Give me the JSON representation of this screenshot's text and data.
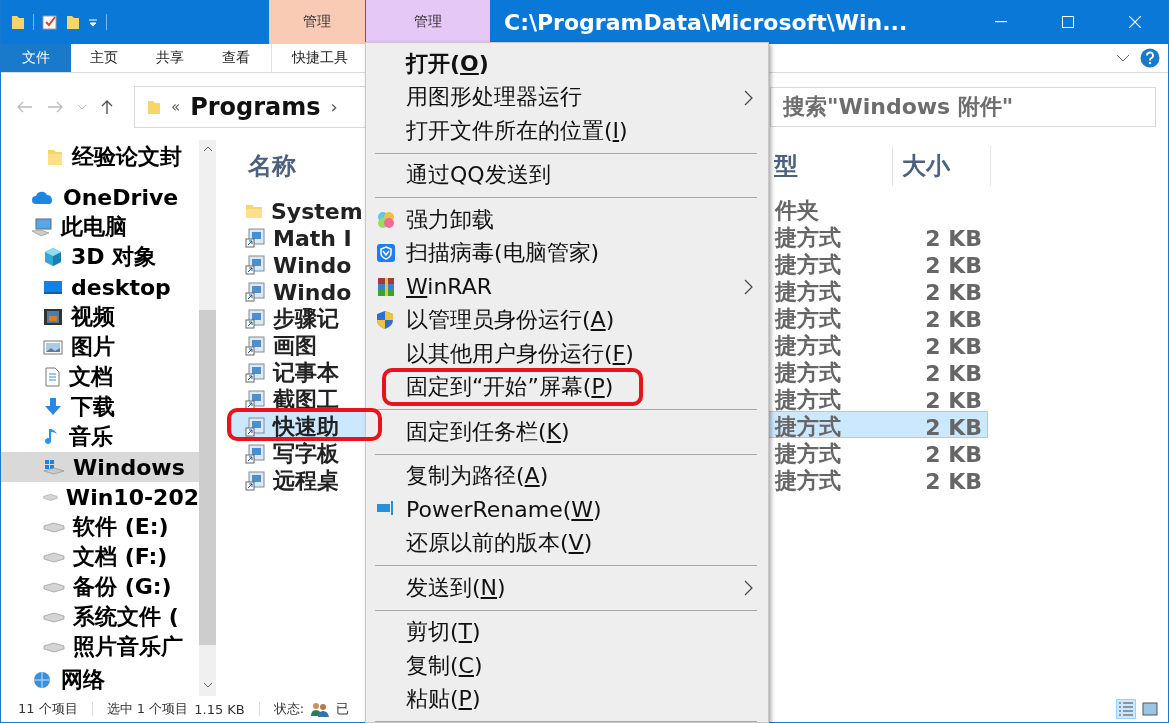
{
  "window": {
    "title": "C:\\ProgramData\\Microsoft\\Win...",
    "context_tabs": [
      {
        "label": "管理",
        "color": "#f9cbb5"
      },
      {
        "label": "管理",
        "color": "#e6c8f7"
      }
    ]
  },
  "ribbon_tabs": [
    {
      "label": "文件",
      "kind": "file",
      "selected": false
    },
    {
      "label": "主页",
      "kind": "tab",
      "selected": false
    },
    {
      "label": "共享",
      "kind": "tab",
      "selected": false
    },
    {
      "label": "查看",
      "kind": "tab",
      "selected": false
    },
    {
      "label": "快捷工具",
      "kind": "context",
      "selected": false
    }
  ],
  "address": {
    "overflow": "«",
    "crumb": "Programs",
    "separator": "›"
  },
  "search": {
    "placeholder": "搜索\"Windows 附件\""
  },
  "nav": [
    {
      "label": "经验论文封",
      "kind": "pinned-folder"
    },
    {
      "label": "OneDrive",
      "kind": "cloud"
    },
    {
      "label": "此电脑",
      "kind": "pc",
      "selected": false,
      "children": [
        {
          "label": "3D 对象",
          "kind": "cube",
          "selected": false
        },
        {
          "label": "desktop",
          "kind": "desktop",
          "selected": false
        },
        {
          "label": "视频",
          "kind": "video",
          "selected": false
        },
        {
          "label": "图片",
          "kind": "pictures",
          "selected": false
        },
        {
          "label": "文档",
          "kind": "documents",
          "selected": false
        },
        {
          "label": "下载",
          "kind": "downloads",
          "selected": false
        },
        {
          "label": "音乐",
          "kind": "music",
          "selected": false
        },
        {
          "label": "Windows",
          "kind": "system-drive",
          "selected": true
        },
        {
          "label": "Win10-202",
          "kind": "drive",
          "selected": false
        },
        {
          "label": "软件 (E:)",
          "kind": "drive",
          "selected": false
        },
        {
          "label": "文档 (F:)",
          "kind": "drive",
          "selected": false
        },
        {
          "label": "备份 (G:)",
          "kind": "drive",
          "selected": false
        },
        {
          "label": "系统文件 (",
          "kind": "drive",
          "selected": false
        },
        {
          "label": "照片音乐广",
          "kind": "drive",
          "selected": false
        }
      ]
    },
    {
      "label": "网络",
      "kind": "network"
    }
  ],
  "table": {
    "columns": [
      "名称",
      "型",
      "大小"
    ],
    "rows": [
      {
        "name": "System",
        "kind": "folder",
        "type": "件夹",
        "selected": false,
        "highlighted": false
      },
      {
        "name": "Math I",
        "kind": "shortcut",
        "type": "捷方式",
        "size": "2 KB",
        "selected": false,
        "highlighted": false
      },
      {
        "name": "Windo",
        "kind": "shortcut",
        "type": "捷方式",
        "size": "2 KB",
        "selected": false,
        "highlighted": false
      },
      {
        "name": "Windo",
        "kind": "shortcut",
        "type": "捷方式",
        "size": "2 KB",
        "selected": false,
        "highlighted": false
      },
      {
        "name": "步骤记",
        "kind": "shortcut",
        "type": "捷方式",
        "size": "2 KB",
        "selected": false,
        "highlighted": false
      },
      {
        "name": "画图",
        "kind": "shortcut",
        "type": "捷方式",
        "size": "2 KB",
        "selected": false,
        "highlighted": false
      },
      {
        "name": "记事本",
        "kind": "shortcut",
        "type": "捷方式",
        "size": "2 KB",
        "selected": false,
        "highlighted": false
      },
      {
        "name": "截图工",
        "kind": "shortcut",
        "type": "捷方式",
        "size": "2 KB",
        "selected": false,
        "highlighted": false
      },
      {
        "name": "快速助",
        "kind": "shortcut",
        "type": "捷方式",
        "size": "2 KB",
        "selected": true,
        "highlighted": true
      },
      {
        "name": "写字板",
        "kind": "shortcut",
        "type": "捷方式",
        "size": "2 KB",
        "selected": false,
        "highlighted": false
      },
      {
        "name": "远程桌",
        "kind": "shortcut",
        "type": "捷方式",
        "size": "2 KB",
        "selected": false,
        "highlighted": false
      }
    ]
  },
  "context_menu": [
    {
      "kind": "item",
      "before": "打开(",
      "key": "O",
      "after": ")",
      "default": true,
      "submenu": false,
      "highlighted": false
    },
    {
      "kind": "item",
      "before": "用图形处理器运行",
      "default": false,
      "submenu": true,
      "highlighted": false
    },
    {
      "kind": "item",
      "before": "打开文件所在的位置(",
      "key": "I",
      "after": ")",
      "default": false,
      "submenu": false,
      "highlighted": false
    },
    {
      "kind": "separator"
    },
    {
      "kind": "item",
      "before": "通过QQ发送到",
      "default": false,
      "submenu": false,
      "highlighted": false
    },
    {
      "kind": "separator"
    },
    {
      "kind": "uninstall",
      "before": "强力卸载",
      "default": false,
      "submenu": false,
      "highlighted": false
    },
    {
      "kind": "antivirus",
      "before": "扫描病毒(电脑管家)",
      "default": false,
      "submenu": false,
      "highlighted": false
    },
    {
      "kind": "archive",
      "key": "W",
      "after": "inRAR",
      "default": false,
      "submenu": true,
      "highlighted": false
    },
    {
      "kind": "admin",
      "before": "以管理员身份运行(",
      "key": "A",
      "after": ")",
      "default": false,
      "submenu": false,
      "highlighted": false
    },
    {
      "kind": "item",
      "before": "以其他用户身份运行(",
      "key": "F",
      "after": ")",
      "default": false,
      "submenu": false,
      "highlighted": false
    },
    {
      "kind": "item",
      "before": "固定到“开始”屏幕(",
      "key": "P",
      "after": ")",
      "default": false,
      "submenu": false,
      "highlighted": true
    },
    {
      "kind": "separator"
    },
    {
      "kind": "item",
      "before": "固定到任务栏(",
      "key": "K",
      "after": ")",
      "default": false,
      "submenu": false,
      "highlighted": false
    },
    {
      "kind": "separator"
    },
    {
      "kind": "item",
      "before": "复制为路径(",
      "key": "A",
      "after": ")",
      "default": false,
      "submenu": false,
      "highlighted": false
    },
    {
      "kind": "rename",
      "before": "PowerRename(",
      "key": "W",
      "after": ")",
      "default": false,
      "submenu": false,
      "highlighted": false
    },
    {
      "kind": "item",
      "before": "还原以前的版本(",
      "key": "V",
      "after": ")",
      "default": false,
      "submenu": false,
      "highlighted": false
    },
    {
      "kind": "separator"
    },
    {
      "kind": "item",
      "before": "发送到(",
      "key": "N",
      "after": ")",
      "default": false,
      "submenu": true,
      "highlighted": false
    },
    {
      "kind": "separator"
    },
    {
      "kind": "item",
      "before": "剪切(",
      "key": "T",
      "after": ")",
      "default": false,
      "submenu": false,
      "highlighted": false
    },
    {
      "kind": "item",
      "before": "复制(",
      "key": "C",
      "after": ")",
      "default": false,
      "submenu": false,
      "highlighted": false
    },
    {
      "kind": "item",
      "before": "粘贴(",
      "key": "P",
      "after": ")",
      "default": false,
      "submenu": false,
      "highlighted": false
    },
    {
      "kind": "separator"
    }
  ],
  "status_bar": {
    "count": "11 个项目",
    "selection": "选中 1 个项目",
    "size": "1.15 KB",
    "state_label": "状态:",
    "state": "已",
    "views": [
      {
        "kind": "details",
        "selected": true
      },
      {
        "kind": "large-icons",
        "selected": false
      }
    ]
  }
}
